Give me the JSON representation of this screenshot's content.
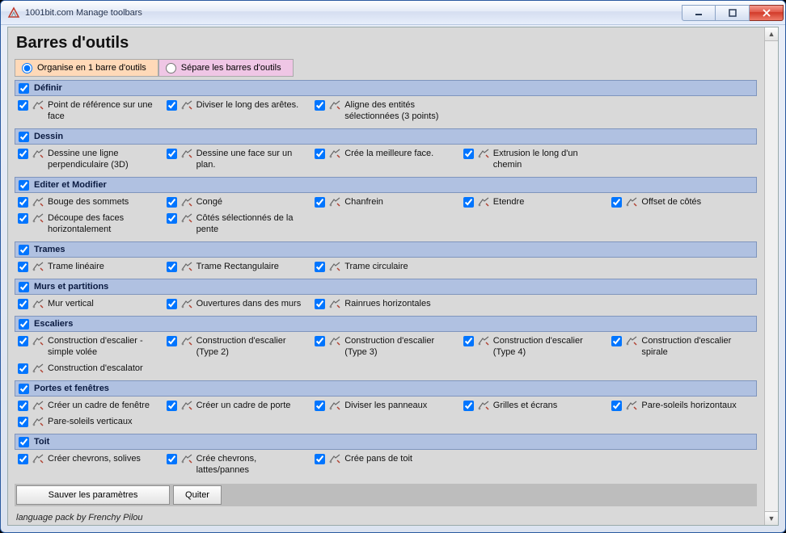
{
  "window": {
    "title": "1001bit.com Manage toolbars"
  },
  "page_heading": "Barres d'outils",
  "radios": {
    "organise": {
      "label": "Organise en 1 barre d'outils",
      "selected": true
    },
    "separate": {
      "label": "Sépare les barres d'outils",
      "selected": false
    }
  },
  "sections": [
    {
      "id": "definir",
      "title": "Définir",
      "items": [
        {
          "label": "Point de référence sur une face"
        },
        {
          "label": "Diviser le long des arêtes."
        },
        {
          "label": "Aligne des entités sélectionnées (3 points)"
        }
      ]
    },
    {
      "id": "dessin",
      "title": "Dessin",
      "items": [
        {
          "label": "Dessine une ligne perpendiculaire (3D)"
        },
        {
          "label": "Dessine une face sur un plan."
        },
        {
          "label": "Crée la meilleure face."
        },
        {
          "label": "Extrusion le long d'un chemin"
        }
      ]
    },
    {
      "id": "editer",
      "title": "Editer et Modifier",
      "items": [
        {
          "label": "Bouge des sommets"
        },
        {
          "label": "Congé"
        },
        {
          "label": "Chanfrein"
        },
        {
          "label": "Etendre"
        },
        {
          "label": "Offset de côtés"
        },
        {
          "label": "Découpe des faces horizontalement"
        },
        {
          "label": "Côtés sélectionnés de la pente"
        }
      ]
    },
    {
      "id": "trames",
      "title": "Trames",
      "items": [
        {
          "label": "Trame linéaire"
        },
        {
          "label": "Trame Rectangulaire"
        },
        {
          "label": "Trame circulaire"
        }
      ]
    },
    {
      "id": "murs",
      "title": "Murs et partitions",
      "items": [
        {
          "label": "Mur vertical"
        },
        {
          "label": "Ouvertures dans des murs"
        },
        {
          "label": "Rainrues horizontales"
        }
      ]
    },
    {
      "id": "escaliers",
      "title": "Escaliers",
      "items": [
        {
          "label": "Construction d'escalier - simple volée"
        },
        {
          "label": "Construction d'escalier (Type 2)"
        },
        {
          "label": "Construction d'escalier (Type 3)"
        },
        {
          "label": "Construction d'escalier (Type 4)"
        },
        {
          "label": "Construction d'escalier spirale"
        },
        {
          "label": "Construction d'escalator"
        }
      ]
    },
    {
      "id": "portes",
      "title": "Portes et fenêtres",
      "items": [
        {
          "label": "Créer un cadre de fenêtre"
        },
        {
          "label": "Créer un cadre de porte"
        },
        {
          "label": "Diviser les panneaux"
        },
        {
          "label": "Grilles et écrans"
        },
        {
          "label": "Pare-soleils horizontaux"
        },
        {
          "label": "Pare-soleils verticaux"
        }
      ]
    },
    {
      "id": "toit",
      "title": "Toit",
      "items": [
        {
          "label": "Créer chevrons, solives"
        },
        {
          "label": "Crée chevrons, lattes/pannes"
        },
        {
          "label": "Crée pans de toit"
        }
      ]
    }
  ],
  "buttons": {
    "save": "Sauver les paramètres",
    "quit": "Quiter"
  },
  "credit": "language pack by Frenchy Pilou"
}
